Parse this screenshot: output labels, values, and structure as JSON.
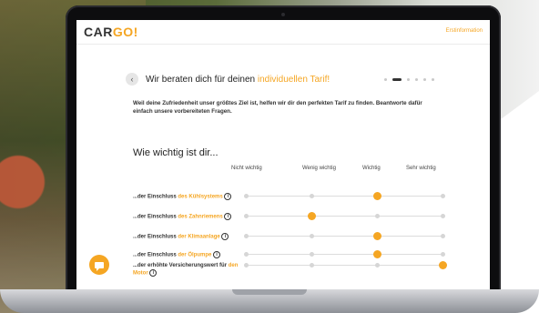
{
  "header": {
    "logo_prefix": "CAR",
    "logo_accent": "GO!",
    "link": "Erstinformation"
  },
  "hero": {
    "back_symbol": "‹",
    "headline_prefix": "Wir beraten dich für deinen ",
    "headline_accent": "individuellen Tarif!",
    "progress": {
      "total_steps": 6,
      "current_step": 2
    },
    "intro": "Weil deine Zufriedenheit unser größtes Ziel ist, helfen wir dir den perfekten Tarif zu finden. Beantworte dafür einfach unsere vorbereiteten Fragen."
  },
  "question": {
    "title": "Wie wichtig ist dir...",
    "columns": [
      "Nicht wichtig",
      "Wenig wichtig",
      "Wichtig",
      "Sehr wichtig"
    ],
    "rows": [
      {
        "prefix": "...der Einschluss ",
        "accent": "des Kühlsystems",
        "suffix": "",
        "info": "i",
        "selected": 2
      },
      {
        "prefix": "...der Einschluss ",
        "accent": "des Zahnriemens",
        "suffix": "",
        "info": "i",
        "selected": 1
      },
      {
        "prefix": "...der Einschluss ",
        "accent": "der Klimaanlage",
        "suffix": "",
        "info": "i",
        "selected": 2
      },
      {
        "prefix": "...der Einschluss ",
        "accent": "der Ölpumpe",
        "suffix": "",
        "info": "i",
        "selected": 2
      },
      {
        "prefix": "...der erhöhte Versicherungswert für ",
        "accent": "den Motor",
        "suffix": "",
        "info": "i",
        "selected": 3
      }
    ]
  },
  "colors": {
    "accent": "#f5a623",
    "text": "#222222",
    "track": "#dcdcdc"
  },
  "icons": {
    "back": "chevron-left-icon",
    "info": "info-icon",
    "chat": "chat-icon"
  }
}
